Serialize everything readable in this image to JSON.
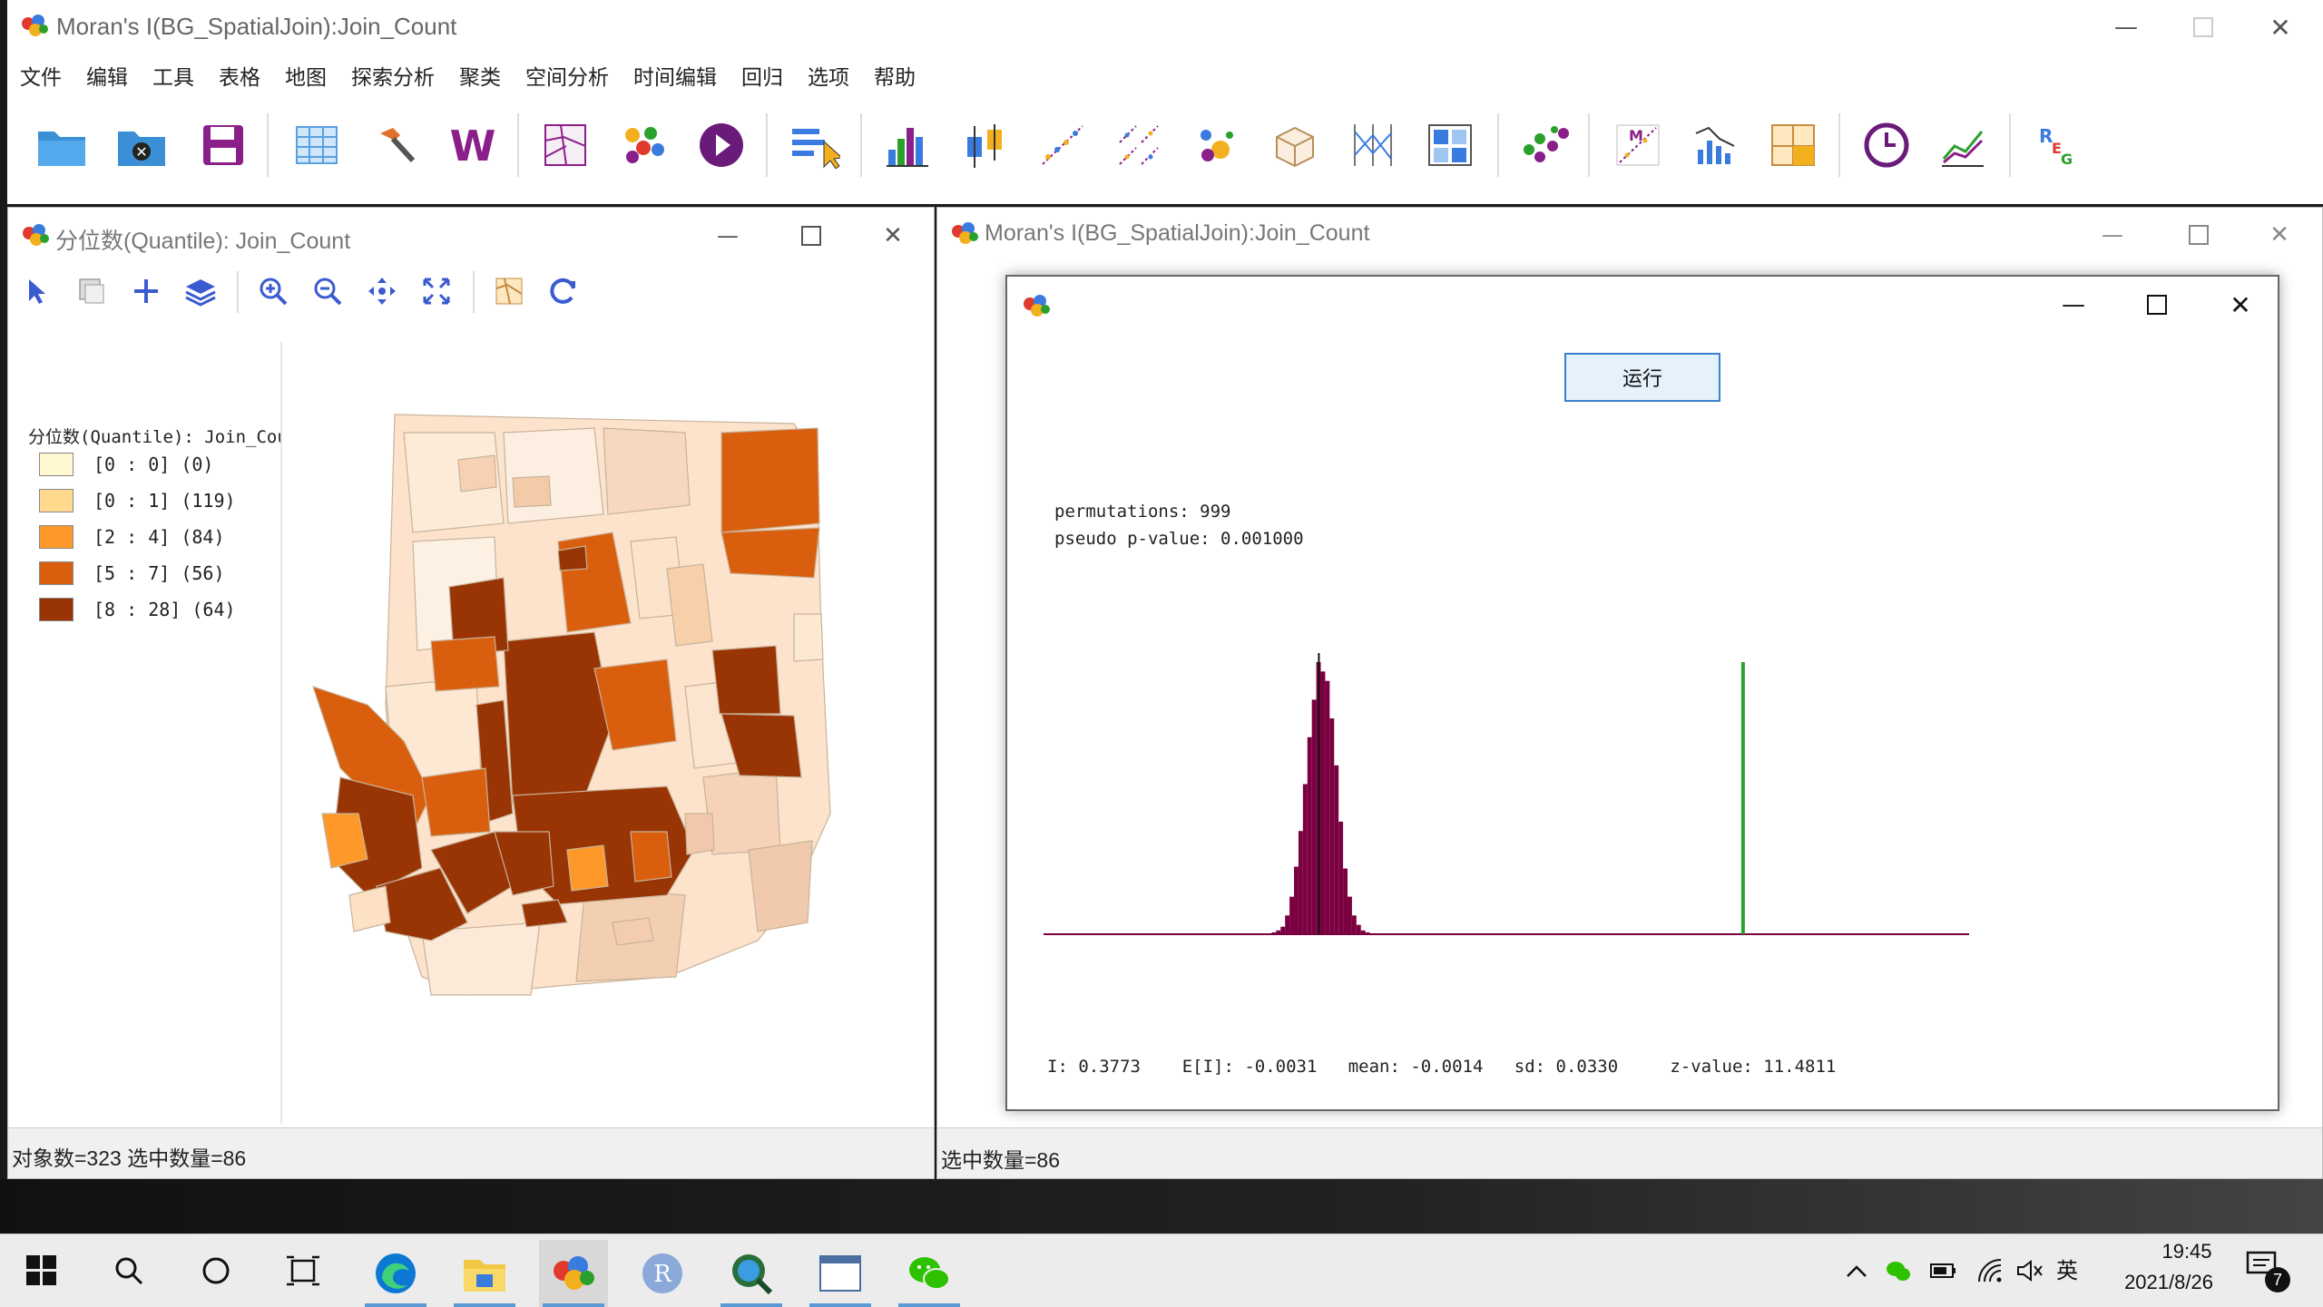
{
  "main_window": {
    "title": "Moran's I(BG_SpatialJoin):Join_Count",
    "menu": [
      "文件",
      "编辑",
      "工具",
      "表格",
      "地图",
      "探索分析",
      "聚类",
      "空间分析",
      "时间编辑",
      "回归",
      "选项",
      "帮助"
    ]
  },
  "map_window": {
    "title": "分位数(Quantile): Join_Count",
    "legend_title": "分位数(Quantile): Join_Count",
    "legend": [
      {
        "label": "[0 : 0]",
        "count": "(0)",
        "color": "#fff7d0"
      },
      {
        "label": "[0 : 1]",
        "count": "(119)",
        "color": "#fed98e"
      },
      {
        "label": "[2 : 4]",
        "count": "(84)",
        "color": "#fe9929"
      },
      {
        "label": "[5 : 7]",
        "count": "(56)",
        "color": "#d95f0e"
      },
      {
        "label": "[8 : 28]",
        "count": "(64)",
        "color": "#993404"
      }
    ],
    "status": "对象数=323 选中数量=86"
  },
  "moran_window": {
    "title": "Moran's I(BG_SpatialJoin):Join_Count",
    "status": "选中数量=86"
  },
  "dialog": {
    "run_button": "运行",
    "permutations": "permutations: 999",
    "pvalue": "pseudo p-value: 0.001000",
    "stats": "I: 0.3773    E[I]: -0.0031   mean: -0.0014   sd: 0.0330     z-value: 11.4811",
    "bar_color": "#7b0040",
    "line_color": "#2ca02c"
  },
  "histogram": {
    "permutations": 999,
    "observed_I": 0.3773,
    "E_I": -0.0031,
    "mean": -0.0014,
    "sd": 0.033,
    "z_value": 11.4811,
    "bins": [
      1,
      2,
      4,
      8,
      20,
      40,
      72,
      110,
      160,
      210,
      250,
      290,
      280,
      270,
      230,
      180,
      120,
      70,
      40,
      20,
      10,
      4,
      2,
      1
    ]
  },
  "taskbar": {
    "time": "19:45",
    "date": "2021/8/26",
    "ime": "英",
    "notification_count": "7"
  }
}
